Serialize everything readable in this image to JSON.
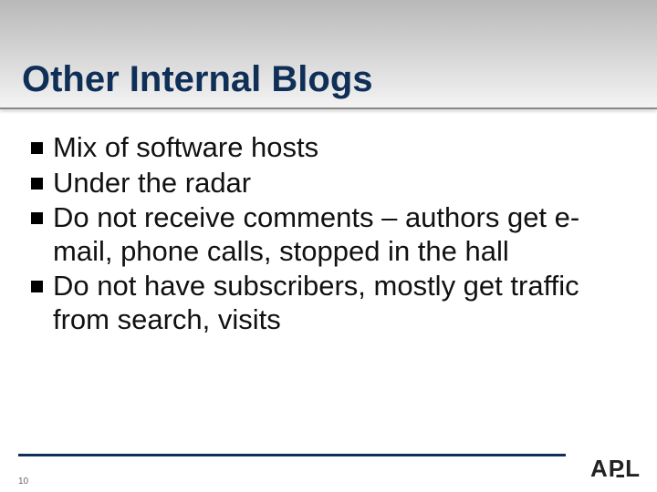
{
  "title": "Other Internal Blogs",
  "bullets": [
    "Mix of software hosts",
    "Under the radar",
    "Do not receive comments – authors get e-mail, phone calls, stopped in the hall",
    "Do not have subscribers, mostly get traffic from search, visits"
  ],
  "slide_number": "10",
  "logo_text": "APL"
}
